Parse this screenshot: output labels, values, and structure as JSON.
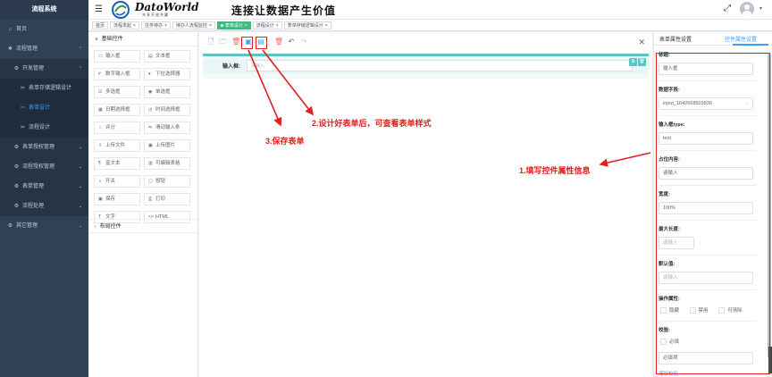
{
  "sidebar": {
    "brand": "流程系统",
    "items": [
      {
        "icon": "home-icon",
        "label": "首页",
        "level": 0
      },
      {
        "icon": "flow-icon",
        "label": "流程管理",
        "level": 0,
        "chev": "⌃"
      },
      {
        "icon": "gear-icon",
        "label": "开发管理",
        "level": 1,
        "chev": "⌃"
      },
      {
        "icon": "tool-icon",
        "label": "表单存储逻辑设计",
        "level": 2
      },
      {
        "icon": "tool-icon",
        "label": "表单设计",
        "level": 2,
        "active": true
      },
      {
        "icon": "tool-icon",
        "label": "流程设计",
        "level": 2
      },
      {
        "icon": "gear-icon",
        "label": "表单授权管理",
        "level": 1,
        "chev": "⌄"
      },
      {
        "icon": "gear-icon",
        "label": "流程授权管理",
        "level": 1,
        "chev": "⌄"
      },
      {
        "icon": "gear-icon",
        "label": "表单管理",
        "level": 1,
        "chev": "⌄"
      },
      {
        "icon": "gear-icon",
        "label": "流程处理",
        "level": 1,
        "chev": "⌄"
      },
      {
        "icon": "gear-icon",
        "label": "其它管理",
        "level": 0,
        "chev": "⌄"
      }
    ]
  },
  "header": {
    "logo_text": "DatoWorld",
    "logo_sub": "共享开放共赢",
    "slogan": "连接让数据产生价值"
  },
  "tags": [
    {
      "label": "首页",
      "active": false
    },
    {
      "label": "流程发起",
      "active": false
    },
    {
      "label": "任务待办",
      "active": false
    },
    {
      "label": "待办人流程监控",
      "active": false
    },
    {
      "label": "表单设计",
      "active": true
    },
    {
      "label": "流程设计",
      "active": false
    },
    {
      "label": "表单存储逻辑设计",
      "active": false
    }
  ],
  "components": {
    "basic_title": "基础控件",
    "layout_title": "布局控件",
    "items": [
      {
        "icon": "input-icon",
        "glyph": "▭",
        "label": "输入框"
      },
      {
        "icon": "textarea-icon",
        "glyph": "▤",
        "label": "文本框"
      },
      {
        "icon": "number-icon",
        "glyph": "#",
        "label": "数字输入框"
      },
      {
        "icon": "select-icon",
        "glyph": "▾",
        "label": "下拉选择器"
      },
      {
        "icon": "checkbox-icon",
        "glyph": "☑",
        "label": "多选框"
      },
      {
        "icon": "radio-icon",
        "glyph": "◉",
        "label": "单选框"
      },
      {
        "icon": "date-icon",
        "glyph": "▦",
        "label": "日期选择框"
      },
      {
        "icon": "time-icon",
        "glyph": "◷",
        "label": "时间选择框"
      },
      {
        "icon": "rate-icon",
        "glyph": "☆",
        "label": "评分"
      },
      {
        "icon": "slider-icon",
        "glyph": "⇋",
        "label": "滑动输入条"
      },
      {
        "icon": "upload-icon",
        "glyph": "⇪",
        "label": "上传文件"
      },
      {
        "icon": "image-icon",
        "glyph": "▣",
        "label": "上传图片"
      },
      {
        "icon": "richtext-icon",
        "glyph": "¶",
        "label": "富文本"
      },
      {
        "icon": "table-icon",
        "glyph": "▥",
        "label": "可编辑表格"
      },
      {
        "icon": "switch-icon",
        "glyph": "◑",
        "label": "开关"
      },
      {
        "icon": "button-icon",
        "glyph": "▢",
        "label": "按钮"
      },
      {
        "icon": "save-icon",
        "glyph": "▣",
        "label": "保存"
      },
      {
        "icon": "print-icon",
        "glyph": "⎙",
        "label": "打印"
      },
      {
        "icon": "text-icon",
        "glyph": "T",
        "label": "文字"
      },
      {
        "icon": "html-icon",
        "glyph": "<>",
        "label": "HTML"
      }
    ]
  },
  "canvas": {
    "field_label": "输入框:",
    "field_placeholder": "请输入"
  },
  "props": {
    "tab_table": "表单属性设置",
    "tab_control": "控件属性设置",
    "title_label": "标题:",
    "title_value": "输入框",
    "field_label": "数据字段:",
    "field_value": "input_1642668503836",
    "type_label": "输入框type:",
    "type_value": "text",
    "placeholder_label": "占位内容:",
    "placeholder_value": "请输入",
    "width_label": "宽度:",
    "width_value": "100%",
    "maxlen_label": "最大长度:",
    "maxlen_placeholder": "请输入",
    "default_label": "默认值:",
    "default_placeholder": "请输入",
    "ops_label": "操作属性:",
    "ops": [
      "隐藏",
      "禁用",
      "可清除"
    ],
    "validate_label": "校验:",
    "required_label": "必填",
    "required_msg": "必填项",
    "more_link": "增加校验"
  },
  "annotations": {
    "step1": "1.填写控件属性信息",
    "step2": "2.设计好表单后，可查看表单样式",
    "step3": "3.保存表单",
    "color": "#e02020"
  }
}
